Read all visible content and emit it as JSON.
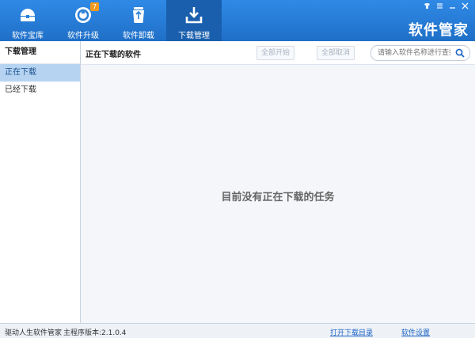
{
  "header": {
    "brand": "软件管家",
    "tabs": [
      {
        "label": "软件宝库",
        "icon": "treasure-box-icon"
      },
      {
        "label": "软件升级",
        "icon": "upgrade-icon",
        "badge": "7"
      },
      {
        "label": "软件卸载",
        "icon": "recycle-bin-icon"
      },
      {
        "label": "下载管理",
        "icon": "download-icon",
        "active": true
      }
    ],
    "window_controls": [
      "skin-icon",
      "menu-icon",
      "minimize-icon",
      "close-icon"
    ]
  },
  "sidebar": {
    "title": "下载管理",
    "items": [
      {
        "label": "正在下载",
        "active": true
      },
      {
        "label": "已经下载"
      }
    ]
  },
  "toolbar": {
    "title": "正在下载的软件",
    "start_all": "全部开始",
    "cancel_all": "全部取消",
    "search_placeholder": "请输入软件名称进行查找"
  },
  "main": {
    "empty_message": "目前没有正在下载的任务"
  },
  "statusbar": {
    "app_name": "驱动人生软件管家",
    "version_text": "主程序版本:2.1.0.4",
    "open_dir_link": "打开下载目录",
    "settings_link": "软件设置"
  },
  "colors": {
    "header_bg": "#2484dc",
    "active_tab_bg": "#1a5fae",
    "sidebar_active_bg": "#b6d4f2",
    "badge_bg": "#f29a1d",
    "link": "#1d64c4"
  }
}
